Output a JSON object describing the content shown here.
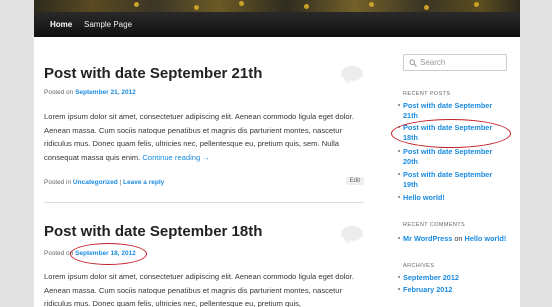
{
  "nav": {
    "home": "Home",
    "sample": "Sample Page"
  },
  "posts": [
    {
      "title": "Post with date September 21th",
      "posted_on": "Posted on",
      "date": "September 21, 2012",
      "excerpt": "Lorem ipsum dolor sit amet, consectetuer adipiscing elit. Aenean commodo ligula eget dolor. Aenean massa. Cum sociis natoque penatibus et magnis dis parturient montes, nascetur ridiculus mus. Donec quam felis, ultricies nec, pellentesque eu, pretium quis, sem. Nulla consequat massa quis enim.",
      "continue": "Continue reading →",
      "posted_in": "Posted in",
      "category": "Uncategorized",
      "separator": "|",
      "reply": "Leave a reply",
      "edit": "Edit"
    },
    {
      "title": "Post with date September 18th",
      "posted_on": "Posted on",
      "date": "September 18, 2012",
      "excerpt": "Lorem ipsum dolor sit amet, consectetuer adipiscing elit. Aenean commodo ligula eget dolor. Aenean massa. Cum sociis natoque penatibus et magnis dis parturient montes, nascetur ridiculus mus. Donec quam felis, ultricies nec, pellentesque eu, pretium quis,"
    }
  ],
  "sidebar": {
    "search_placeholder": "Search",
    "recent_posts_title": "RECENT POSTS",
    "recent_posts": [
      "Post with date September 21th",
      "Post with date September 18th",
      "Post with date September 20th",
      "Post with date September 19th",
      "Hello world!"
    ],
    "recent_comments_title": "RECENT COMMENTS",
    "comment": {
      "author": "Mr WordPress",
      "on": "on",
      "post": "Hello world!"
    },
    "archives_title": "ARCHIVES",
    "archives": [
      "September 2012",
      "February 2012"
    ]
  },
  "colors": {
    "link": "#1b8be0",
    "annotation": "#c21e26",
    "navbar": "#111111"
  }
}
